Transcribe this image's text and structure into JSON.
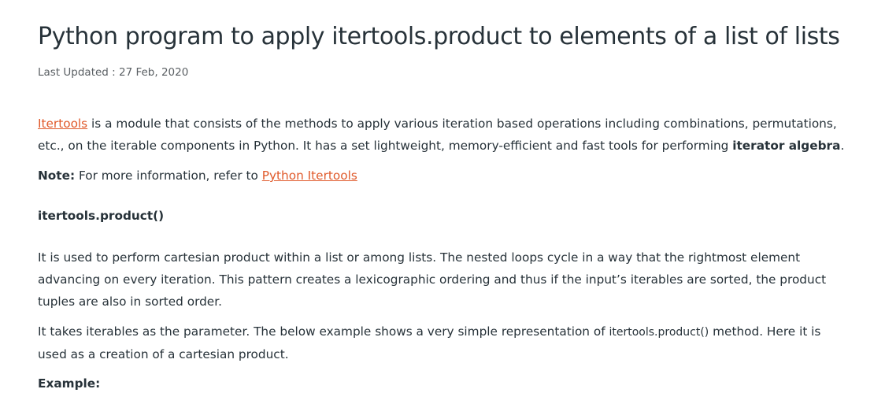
{
  "article": {
    "title": "Python program to apply itertools.product to elements of a list of lists",
    "last_updated": "Last Updated : 27 Feb, 2020",
    "intro": {
      "link_text": "Itertools",
      "text_part1": " is a module that consists of the methods to apply various iteration based operations including combinations, permutations, etc., on the iterable components in Python. It has a set lightweight, memory-efficient and fast tools for performing ",
      "bold_text": "iterator algebra",
      "text_part2": "."
    },
    "note": {
      "label": "Note:",
      "text": " For more information, refer to ",
      "link_text": "Python Itertools"
    },
    "section_heading": "itertools.product()",
    "para1": "It is used to perform cartesian product within a list or among lists. The nested loops cycle in a way that the rightmost element advancing on every iteration. This pattern creates a lexicographic ordering and thus if the input’s iterables are sorted, the product tuples are also in sorted order.",
    "para2": {
      "text_part1": "It takes iterables as the parameter. The below example shows a very simple representation of ",
      "code": "itertools.product()",
      "text_part2": " method. Here it is used as a creation of a cartesian product."
    },
    "example_label": "Example:"
  },
  "colors": {
    "text": "#273239",
    "link": "#e05a2b",
    "muted": "#5a5f63"
  }
}
